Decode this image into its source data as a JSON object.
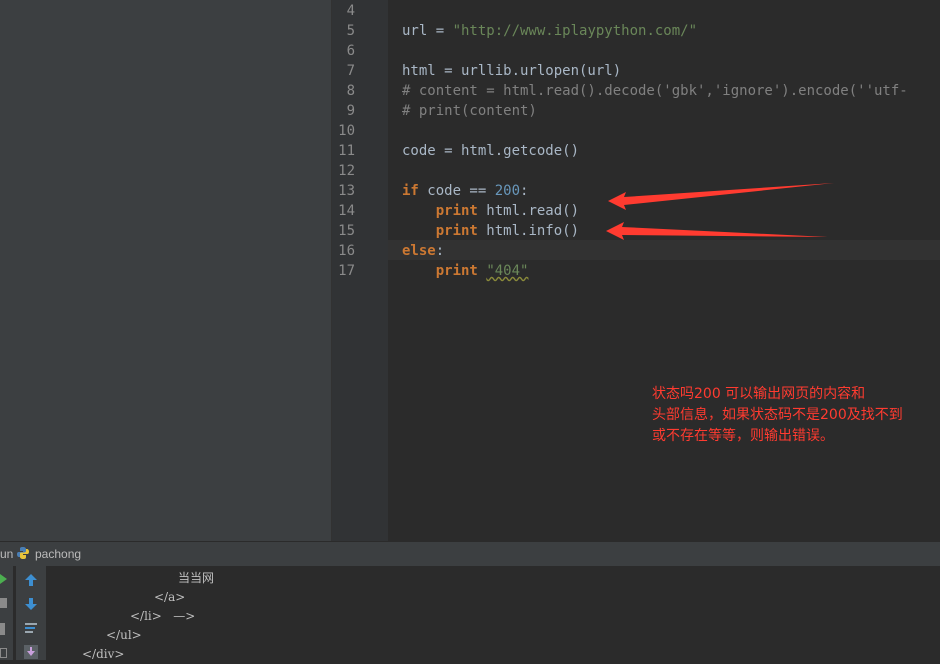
{
  "editor": {
    "lines": [
      {
        "num": "4",
        "text": ""
      },
      {
        "num": "5",
        "text": "url = \"http://www.iplaypython.com/\""
      },
      {
        "num": "6",
        "text": ""
      },
      {
        "num": "7",
        "text": "html = urllib.urlopen(url)"
      },
      {
        "num": "8",
        "text": "# content = html.read().decode('gbk','ignore').encode(''utf-"
      },
      {
        "num": "9",
        "text": "# print(content)"
      },
      {
        "num": "10",
        "text": ""
      },
      {
        "num": "11",
        "text": "code = html.getcode()"
      },
      {
        "num": "12",
        "text": ""
      },
      {
        "num": "13",
        "text": "if code == 200:"
      },
      {
        "num": "14",
        "text": "    print html.read()"
      },
      {
        "num": "15",
        "text": "    print html.info()"
      },
      {
        "num": "16",
        "text": "else:"
      },
      {
        "num": "17",
        "text": "    print \"404\""
      }
    ],
    "annotation": [
      "状态吗200 可以输出网页的内容和",
      "头部信息，如果状态码不是200及找不到",
      "或不存在等等，则输出错误。"
    ],
    "annotation_color": "#ff3b30"
  },
  "run_panel": {
    "label": "un",
    "config_name": "pachong",
    "console_lines": [
      "当当网",
      "</a>",
      "</li>   —>",
      "</ul>",
      "</div>"
    ]
  },
  "icons": [
    "python-icon",
    "run-icon",
    "stop-icon",
    "up-arrow-icon",
    "down-arrow-icon",
    "soft-wrap-icon",
    "scroll-end-icon"
  ]
}
